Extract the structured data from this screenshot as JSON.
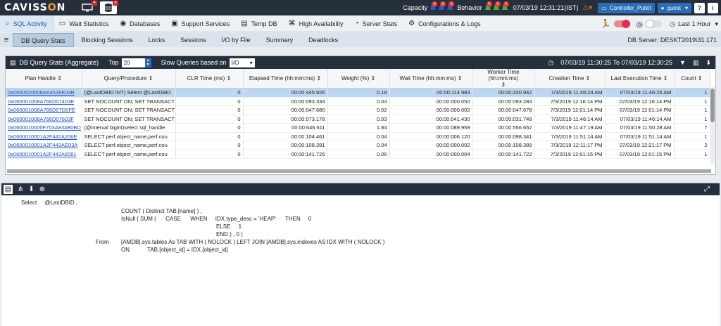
{
  "app": {
    "logo_left": "CAVISS",
    "logo_o": "O",
    "logo_right": "N"
  },
  "top": {
    "capacity_label": "Capacity",
    "capacity_counts": [
      "0",
      "0",
      "0"
    ],
    "behavior_label": "Behavior",
    "behavior_counts": [
      "0",
      "0",
      "0"
    ],
    "datetime": "07/03/19 12:31:21(IST)",
    "controller": "Controller_Pulkit",
    "user": "guest",
    "help": "?",
    "info": "i"
  },
  "nav": {
    "items": [
      {
        "label": "SQL Activity",
        "icon": "sql-icon"
      },
      {
        "label": "Wait Statistics",
        "icon": "monitor-icon"
      },
      {
        "label": "Databases",
        "icon": "database-icon"
      },
      {
        "label": "Support Services",
        "icon": "services-icon"
      },
      {
        "label": "Temp DB",
        "icon": "tempdb-icon"
      },
      {
        "label": "High Availability",
        "icon": "network-icon"
      },
      {
        "label": "Server Stats",
        "icon": "gauge-icon"
      },
      {
        "label": "Configurations & Logs",
        "icon": "gear-icon"
      }
    ],
    "time_range": "Last 1 Hour"
  },
  "subtabs": {
    "items": [
      "DB Query Stats",
      "Blocking Sessions",
      "Locks",
      "Sessions",
      "I/O by File",
      "Summary",
      "Deadlocks"
    ],
    "db_server": "DB Server: DESKT2019\\31.171"
  },
  "grid": {
    "title": "DB Query Stats (Aggregate)",
    "top_label": "Top",
    "top_value": "20",
    "slow_label": "Slow Queries based on",
    "slow_value": "I/O",
    "range": "07/03/19 11:30:25 To 07/03/19 12:30:25",
    "columns": [
      "Plan Handle",
      "Query/Procedure",
      "CLR Time (ms)",
      "Elapsed Time (hh:mm:ms)",
      "Weight (%)",
      "Wait Time (hh:mm:ms)",
      "Worker Time (hh:mm:ms)",
      "Creation Time",
      "Last Execution Time",
      "Count"
    ],
    "rows": [
      [
        "0x0600020008AA4529E04B",
        "(@LastDBID INT) Select @LastDBID",
        "0",
        "00:00:445.926",
        "0.18",
        "00:00:114.984",
        "00:00:330.942",
        "7/3/2019 11:46:24 AM",
        "07/03/19 11:46:25 AM",
        "1"
      ],
      [
        "0x060001008A766D07403E",
        "SET NOCOUNT ON; SET TRANSACT",
        "0",
        "00:00:093.334",
        "0.04",
        "00:00:000.050",
        "00:00:093.284",
        "7/3/2019 12:16:14 PM",
        "07/03/19 12:16:14 PM",
        "1"
      ],
      [
        "0x060001008A766D07D0FE",
        "SET NOCOUNT ON; SET TRANSACT",
        "0",
        "00:00:047.680",
        "0.02",
        "00:00:000.002",
        "00:00:047.678",
        "7/3/2019 12:01:14 PM",
        "07/03/19 12:01:14 PM",
        "1"
      ],
      [
        "0x060001008A766D07603F",
        "SET NOCOUNT ON; SET TRANSACT",
        "0",
        "00:00:073.178",
        "0.03",
        "00:00:041.430",
        "00:00:031.748",
        "7/3/2019 11:46:14 AM",
        "07/03/19 11:46:14 AM",
        "1"
      ],
      [
        "0x0600010000F703A834B0BD",
        "(@interval bigint)select sql_handle",
        "0",
        "00:00:646.611",
        "1.84",
        "00:00:089.959",
        "00:00:556.652",
        "7/3/2019 11:47:19 AM",
        "07/03/19 11:50:28 AM",
        "7"
      ],
      [
        "0x0600010001A2F442A206E",
        "SELECT perf.object_name,perf.cou",
        "0",
        "00:00:104.461",
        "0.04",
        "00:00:006.120",
        "00:00:098.341",
        "7/3/2019 11:51:14 AM",
        "07/03/19 11:51:14 AM",
        "1"
      ],
      [
        "0x0600010001A2F442AE03A",
        "SELECT perf.object_name,perf.cou",
        "0",
        "00:00:108.391",
        "0.04",
        "00:00:000.002",
        "00:00:108.389",
        "7/3/2019 12:11:17 PM",
        "07/03/19 12:21:17 PM",
        "2"
      ],
      [
        "0x0600010001A2F442A6081",
        "SELECT perf.object_name,perf.cou",
        "0",
        "00:00:141.726",
        "0.06",
        "00:00:000.004",
        "00:00:141.722",
        "7/3/2019 12:01:15 PM",
        "07/03/19 12:01:15 PM",
        "1"
      ]
    ]
  },
  "query": {
    "lines": [
      "Select     @LastDBID ,",
      "COUNT ( Distinct TAB.[name] ) ,",
      "IsNull ( SUM (      CASE      WHEN     IDX.type_desc = 'HEAP'      THEN     0",
      "ELSE     1",
      "END ) , 0 )",
      "From",
      "[AMDB].sys.tables As TAB WITH ( NOLOCK ) LEFT JOIN [AMDB].sys.indexes AS IDX WITH ( NOLOCK )",
      "ON",
      "TAB.[object_id] = IDX.[object_id]"
    ]
  }
}
